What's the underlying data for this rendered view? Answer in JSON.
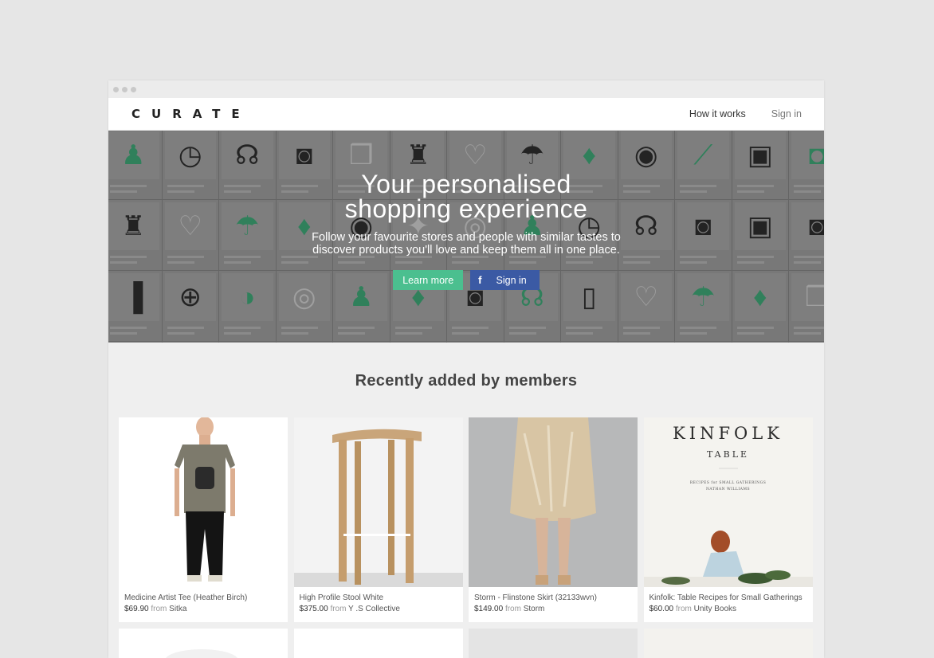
{
  "nav": {
    "logo": "CURATE",
    "links": [
      {
        "label": "How it works"
      },
      {
        "label": "Sign in"
      }
    ]
  },
  "hero": {
    "title_line1": "Your personalised",
    "title_line2": "shopping experience",
    "sub_line1": "Follow your favourite stores and people with similar tastes to",
    "sub_line2": "discover products you'll love and keep them all in one place.",
    "learn_more": "Learn more",
    "sign_in": "Sign in",
    "fb_icon": "f"
  },
  "recent": {
    "title": "Recently added by members"
  },
  "products": [
    {
      "name": "Medicine Artist Tee (Heather Birch)",
      "price": "$69.90",
      "from_label": "from",
      "store": "Sitka"
    },
    {
      "name": "High Profile Stool White",
      "price": "$375.00",
      "from_label": "from",
      "store": "Y .S Collective"
    },
    {
      "name": "Storm - Flinstone Skirt (32133wvn)",
      "price": "$149.00",
      "from_label": "from",
      "store": "Storm"
    },
    {
      "name": "Kinfolk: Table Recipes for Small Gatherings",
      "price": "$60.00",
      "from_label": "from",
      "store": "Unity Books"
    }
  ],
  "kinfolk": {
    "title": "KINFOLK",
    "subtitle": "TABLE",
    "tag1": "RECIPES for SMALL GATHERINGS",
    "tag2": "NATHAN WILLIAMS"
  },
  "colors": {
    "accent_green": "#4bbf8f",
    "facebook_blue": "#3b5aa4"
  }
}
